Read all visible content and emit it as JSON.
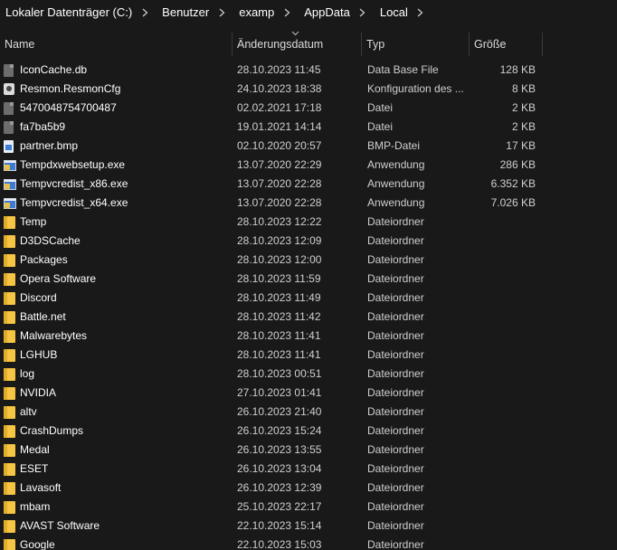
{
  "breadcrumb": [
    "Lokaler Datenträger (C:)",
    "Benutzer",
    "examp",
    "AppData",
    "Local"
  ],
  "columns": {
    "name": "Name",
    "date": "Änderungsdatum",
    "type": "Typ",
    "size": "Größe"
  },
  "files": [
    {
      "name": "IconCache.db",
      "date": "28.10.2023 11:45",
      "type": "Data Base File",
      "size": "128 KB",
      "icon": "database-file-icon"
    },
    {
      "name": "Resmon.ResmonCfg",
      "date": "24.10.2023 18:38",
      "type": "Konfiguration des ...",
      "size": "8 KB",
      "icon": "config-file-icon"
    },
    {
      "name": "5470048754700487",
      "date": "02.02.2021 17:18",
      "type": "Datei",
      "size": "2 KB",
      "icon": "file-icon"
    },
    {
      "name": "fa7ba5b9",
      "date": "19.01.2021 14:14",
      "type": "Datei",
      "size": "2 KB",
      "icon": "file-icon"
    },
    {
      "name": "partner.bmp",
      "date": "02.10.2020 20:57",
      "type": "BMP-Datei",
      "size": "17 KB",
      "icon": "bitmap-file-icon"
    },
    {
      "name": "Tempdxwebsetup.exe",
      "date": "13.07.2020 22:29",
      "type": "Anwendung",
      "size": "286 KB",
      "icon": "installer-exe-icon"
    },
    {
      "name": "Tempvcredist_x86.exe",
      "date": "13.07.2020 22:28",
      "type": "Anwendung",
      "size": "6.352 KB",
      "icon": "installer-exe-icon"
    },
    {
      "name": "Tempvcredist_x64.exe",
      "date": "13.07.2020 22:28",
      "type": "Anwendung",
      "size": "7.026 KB",
      "icon": "installer-exe-icon"
    },
    {
      "name": "Temp",
      "date": "28.10.2023 12:22",
      "type": "Dateiordner",
      "size": "",
      "icon": "folder-icon"
    },
    {
      "name": "D3DSCache",
      "date": "28.10.2023 12:09",
      "type": "Dateiordner",
      "size": "",
      "icon": "folder-icon"
    },
    {
      "name": "Packages",
      "date": "28.10.2023 12:00",
      "type": "Dateiordner",
      "size": "",
      "icon": "folder-icon"
    },
    {
      "name": "Opera Software",
      "date": "28.10.2023 11:59",
      "type": "Dateiordner",
      "size": "",
      "icon": "folder-icon"
    },
    {
      "name": "Discord",
      "date": "28.10.2023 11:49",
      "type": "Dateiordner",
      "size": "",
      "icon": "folder-icon"
    },
    {
      "name": "Battle.net",
      "date": "28.10.2023 11:42",
      "type": "Dateiordner",
      "size": "",
      "icon": "folder-icon"
    },
    {
      "name": "Malwarebytes",
      "date": "28.10.2023 11:41",
      "type": "Dateiordner",
      "size": "",
      "icon": "folder-icon"
    },
    {
      "name": "LGHUB",
      "date": "28.10.2023 11:41",
      "type": "Dateiordner",
      "size": "",
      "icon": "folder-icon"
    },
    {
      "name": "log",
      "date": "28.10.2023 00:51",
      "type": "Dateiordner",
      "size": "",
      "icon": "folder-icon"
    },
    {
      "name": "NVIDIA",
      "date": "27.10.2023 01:41",
      "type": "Dateiordner",
      "size": "",
      "icon": "folder-icon"
    },
    {
      "name": "altv",
      "date": "26.10.2023 21:40",
      "type": "Dateiordner",
      "size": "",
      "icon": "folder-icon"
    },
    {
      "name": "CrashDumps",
      "date": "26.10.2023 15:24",
      "type": "Dateiordner",
      "size": "",
      "icon": "folder-icon"
    },
    {
      "name": "Medal",
      "date": "26.10.2023 13:55",
      "type": "Dateiordner",
      "size": "",
      "icon": "folder-icon"
    },
    {
      "name": "ESET",
      "date": "26.10.2023 13:04",
      "type": "Dateiordner",
      "size": "",
      "icon": "folder-icon"
    },
    {
      "name": "Lavasoft",
      "date": "26.10.2023 12:39",
      "type": "Dateiordner",
      "size": "",
      "icon": "folder-icon"
    },
    {
      "name": "mbam",
      "date": "25.10.2023 22:17",
      "type": "Dateiordner",
      "size": "",
      "icon": "folder-icon"
    },
    {
      "name": "AVAST Software",
      "date": "22.10.2023 15:14",
      "type": "Dateiordner",
      "size": "",
      "icon": "folder-icon"
    },
    {
      "name": "Google",
      "date": "22.10.2023 15:03",
      "type": "Dateiordner",
      "size": "",
      "icon": "folder-icon"
    }
  ],
  "colors": {
    "background": "#191919",
    "text": "#ffffff",
    "secondary_text": "#cfcfcf",
    "folder": "#f6c544",
    "divider": "#3a3a3a"
  }
}
